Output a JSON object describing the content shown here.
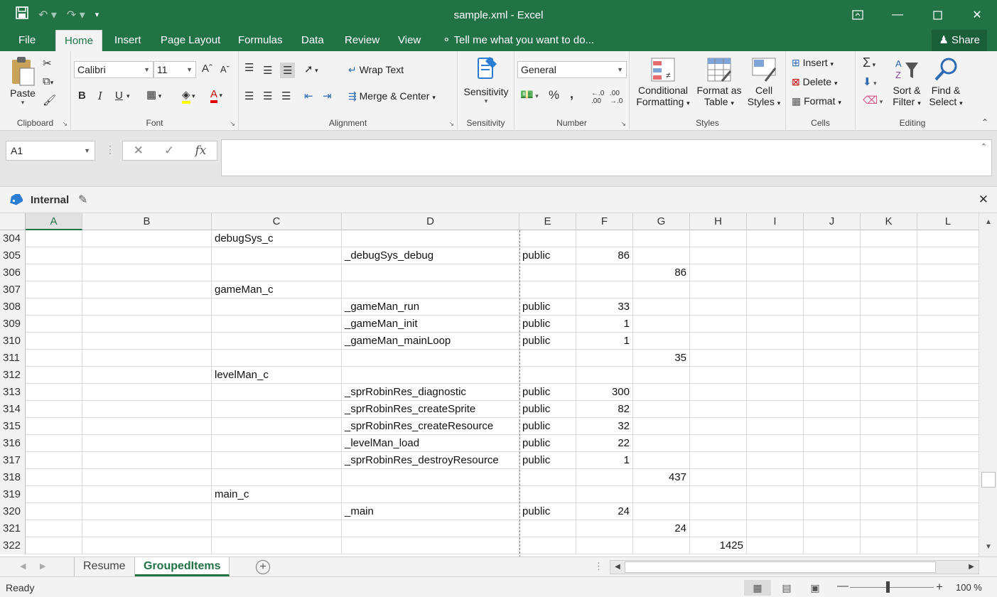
{
  "window": {
    "title": "sample.xml - Excel"
  },
  "menu": {
    "tabs": [
      "File",
      "Home",
      "Insert",
      "Page Layout",
      "Formulas",
      "Data",
      "Review",
      "View"
    ],
    "active": "Home",
    "tell_me": "Tell me what you want to do...",
    "share": "Share"
  },
  "ribbon": {
    "clipboard": {
      "label": "Clipboard",
      "paste": "Paste"
    },
    "font": {
      "label": "Font",
      "name": "Calibri",
      "size": "11",
      "bold": "B",
      "italic": "I",
      "underline": "U"
    },
    "alignment": {
      "label": "Alignment",
      "wrap_text": "Wrap Text",
      "merge_center": "Merge & Center"
    },
    "sensitivity": {
      "label": "Sensitivity",
      "button": "Sensitivity"
    },
    "number": {
      "label": "Number",
      "format": "General",
      "percent": "%",
      "comma": ","
    },
    "styles": {
      "label": "Styles",
      "conditional": [
        "Conditional",
        "Formatting"
      ],
      "format_table": [
        "Format as",
        "Table"
      ],
      "cell_styles": [
        "Cell",
        "Styles"
      ]
    },
    "cells": {
      "label": "Cells",
      "insert": "Insert",
      "delete": "Delete",
      "format": "Format"
    },
    "editing": {
      "label": "Editing",
      "sort_filter": [
        "Sort &",
        "Filter"
      ],
      "find_select": [
        "Find &",
        "Select"
      ]
    }
  },
  "formula_bar": {
    "name_box": "A1",
    "formula": ""
  },
  "info_bar": {
    "label": "Internal"
  },
  "grid": {
    "columns": [
      "A",
      "B",
      "C",
      "D",
      "E",
      "F",
      "G",
      "H",
      "I",
      "J",
      "K",
      "L"
    ],
    "active_column": "A",
    "rows": [
      {
        "num": "304",
        "C": "debugSys_c"
      },
      {
        "num": "305",
        "D": "_debugSys_debug",
        "E": "public",
        "F": "86"
      },
      {
        "num": "306",
        "G": "86"
      },
      {
        "num": "307",
        "C": "gameMan_c"
      },
      {
        "num": "308",
        "D": "_gameMan_run",
        "E": "public",
        "F": "33"
      },
      {
        "num": "309",
        "D": "_gameMan_init",
        "E": "public",
        "F": "1"
      },
      {
        "num": "310",
        "D": "_gameMan_mainLoop",
        "E": "public",
        "F": "1"
      },
      {
        "num": "311",
        "G": "35"
      },
      {
        "num": "312",
        "C": "levelMan_c"
      },
      {
        "num": "313",
        "D": "_sprRobinRes_diagnostic",
        "E": "public",
        "F": "300"
      },
      {
        "num": "314",
        "D": "_sprRobinRes_createSprite",
        "E": "public",
        "F": "82"
      },
      {
        "num": "315",
        "D": "_sprRobinRes_createResource",
        "E": "public",
        "F": "32"
      },
      {
        "num": "316",
        "D": "_levelMan_load",
        "E": "public",
        "F": "22"
      },
      {
        "num": "317",
        "D": "_sprRobinRes_destroyResource",
        "E": "public",
        "F": "1"
      },
      {
        "num": "318",
        "G": "437"
      },
      {
        "num": "319",
        "C": "main_c"
      },
      {
        "num": "320",
        "D": "_main",
        "E": "public",
        "F": "24"
      },
      {
        "num": "321",
        "G": "24"
      },
      {
        "num": "322",
        "H": "1425"
      }
    ]
  },
  "sheets": {
    "tabs": [
      "Resume",
      "GroupedItems"
    ],
    "active": "GroupedItems"
  },
  "status": {
    "ready": "Ready",
    "zoom": "100 %"
  },
  "colors": {
    "accent": "#217346"
  }
}
